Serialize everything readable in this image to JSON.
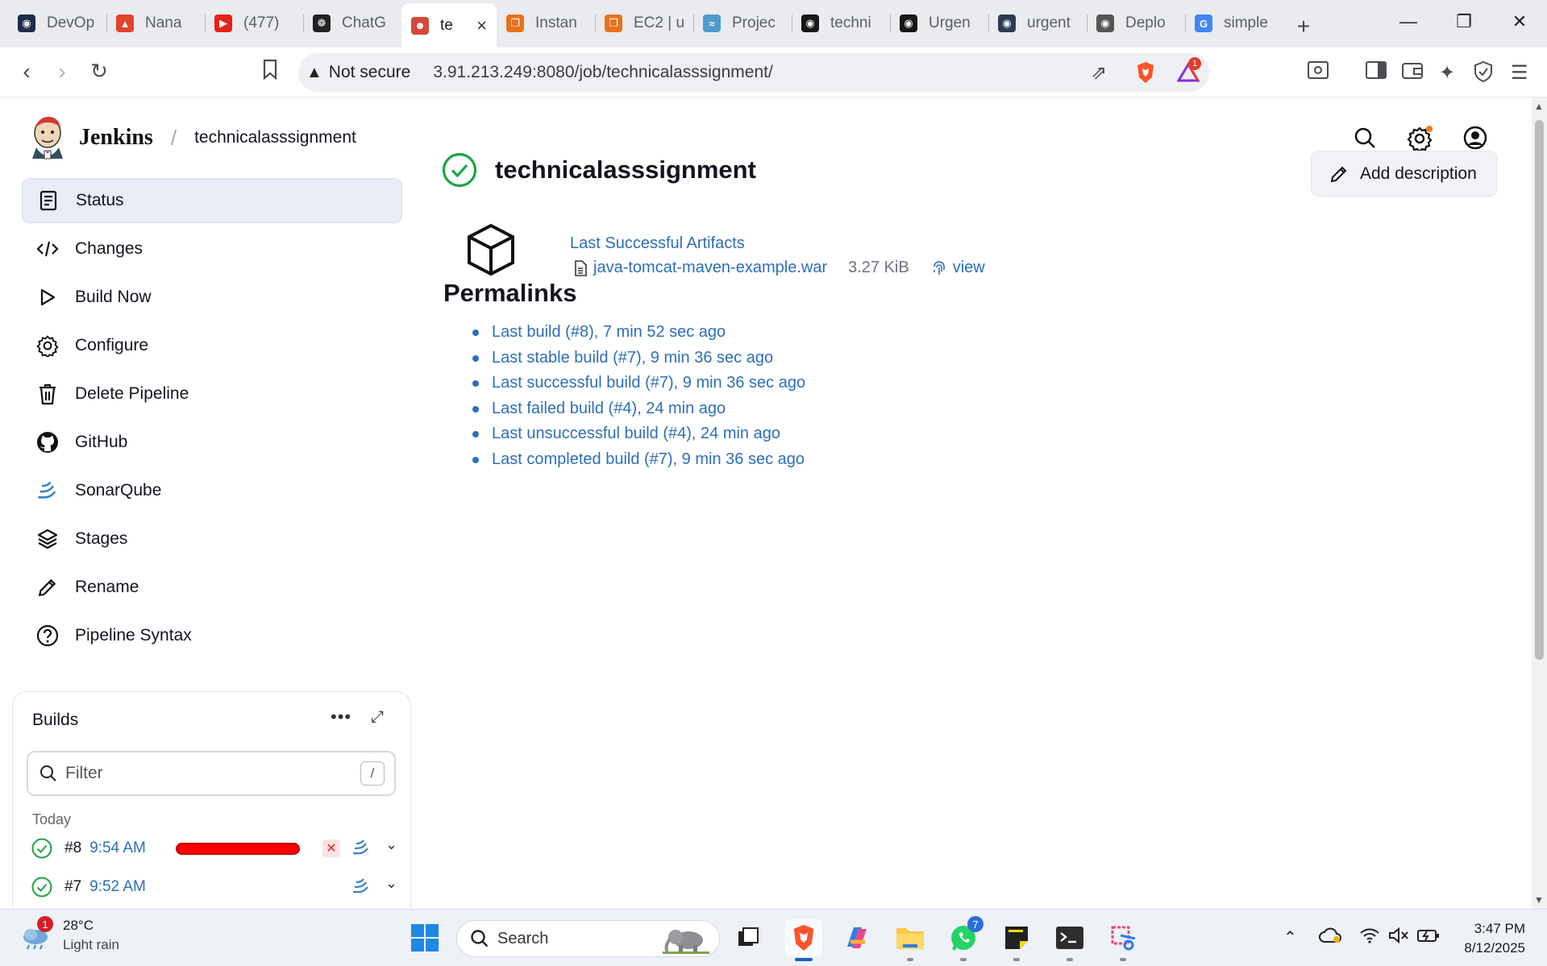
{
  "browser": {
    "tabs": [
      {
        "title": "DevOp",
        "icon": "devops-icon",
        "color": "#1f2d4a"
      },
      {
        "title": "Nana",
        "icon": "gitlab-icon",
        "color": "#e2432a"
      },
      {
        "title": "(477)",
        "icon": "youtube-icon",
        "color": "#e62117"
      },
      {
        "title": "ChatG",
        "icon": "chatgpt-icon",
        "color": "#222222"
      },
      {
        "title": "te",
        "icon": "jenkins-icon",
        "color": "#d24939"
      },
      {
        "title": "Instan",
        "icon": "aws-icon",
        "color": "#e8731b"
      },
      {
        "title": "EC2 | u",
        "icon": "aws-icon",
        "color": "#e8731b"
      },
      {
        "title": "Projec",
        "icon": "sonarqube-icon",
        "color": "#4e9bcd"
      },
      {
        "title": "techni",
        "icon": "github-icon",
        "color": "#181717"
      },
      {
        "title": "Urgen",
        "icon": "github-icon",
        "color": "#181717"
      },
      {
        "title": "urgent",
        "icon": "web-icon",
        "color": "#2f3b52"
      },
      {
        "title": "Deplo",
        "icon": "globe-icon",
        "color": "#555555"
      },
      {
        "title": "simple",
        "icon": "google-icon",
        "color": "#4285f4"
      }
    ],
    "active_tab_index": 4,
    "security_label": "Not secure",
    "url": "3.91.213.249:8080/job/technicalasssignment/",
    "notification_count": "1"
  },
  "jenkins": {
    "brand": "Jenkins",
    "breadcrumb": "technicalasssignment",
    "sidebar": [
      {
        "label": "Status",
        "icon": "status-icon",
        "active": true
      },
      {
        "label": "Changes",
        "icon": "code-icon"
      },
      {
        "label": "Build Now",
        "icon": "play-icon"
      },
      {
        "label": "Configure",
        "icon": "gear-icon"
      },
      {
        "label": "Delete Pipeline",
        "icon": "trash-icon"
      },
      {
        "label": "GitHub",
        "icon": "github-icon"
      },
      {
        "label": "SonarQube",
        "icon": "sonarqube-icon"
      },
      {
        "label": "Stages",
        "icon": "layers-icon"
      },
      {
        "label": "Rename",
        "icon": "pencil-icon"
      },
      {
        "label": "Pipeline Syntax",
        "icon": "help-icon"
      }
    ],
    "builds": {
      "title": "Builds",
      "filter_placeholder": "Filter",
      "filter_shortcut": "/",
      "group_label": "Today",
      "rows": [
        {
          "number": "#8",
          "time": "9:54 AM",
          "status": "success",
          "in_progress": true
        },
        {
          "number": "#7",
          "time": "9:52 AM",
          "status": "success",
          "in_progress": false
        }
      ]
    },
    "job": {
      "title": "technicalasssignment",
      "status": "success",
      "add_description_label": "Add description",
      "artifacts_title": "Last Successful Artifacts",
      "artifact_file": "java-tomcat-maven-example.war",
      "artifact_size": "3.27 KiB",
      "artifact_view_label": "view",
      "permalinks_heading": "Permalinks",
      "permalinks": [
        "Last build (#8), 7 min 52 sec ago",
        "Last stable build (#7), 9 min 36 sec ago",
        "Last successful build (#7), 9 min 36 sec ago",
        "Last failed build (#4), 24 min ago",
        "Last unsuccessful build (#4), 24 min ago",
        "Last completed build (#7), 9 min 36 sec ago"
      ]
    }
  },
  "taskbar": {
    "weather_temp": "28°C",
    "weather_desc": "Light rain",
    "weather_badge": "1",
    "search_label": "Search",
    "whatsapp_badge": "7",
    "time": "3:47 PM",
    "date": "8/12/2025"
  },
  "colors": {
    "link": "#2e6eb8",
    "success": "#1ea446",
    "progress": "#ff0000"
  }
}
